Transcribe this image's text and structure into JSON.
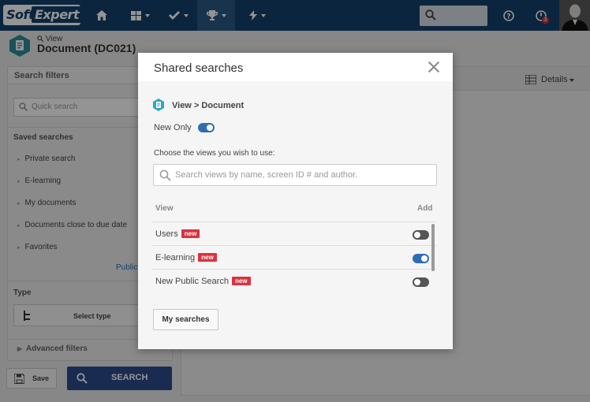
{
  "app": {
    "logo_part1": "Soft",
    "logo_part2": "Expert",
    "notification_count": "3"
  },
  "page": {
    "view_link": "View",
    "title": "Document (DC021)"
  },
  "left_panel": {
    "header": "Search filters",
    "quick_search_placeholder": "Quick search",
    "saved_searches_title": "Saved searches",
    "saved_searches": [
      {
        "label": "Private search"
      },
      {
        "label": "E-learning"
      },
      {
        "label": "My documents"
      },
      {
        "label": "Documents close to due date"
      },
      {
        "label": "Favorites"
      }
    ],
    "public_link": "Public",
    "type_title": "Type",
    "select_type_label": "Select type",
    "advanced_filters": "Advanced filters"
  },
  "footer": {
    "save_label": "Save",
    "search_label": "SEARCH"
  },
  "right_panel": {
    "details_label": "Details"
  },
  "modal": {
    "title": "Shared searches",
    "breadcrumb": "View > Document",
    "new_only_label": "New Only",
    "new_only_enabled": true,
    "choose_label": "Choose the views you wish to use:",
    "search_placeholder": "Search views by name, screen ID # and author.",
    "col_view": "View",
    "col_add": "Add",
    "rows": [
      {
        "name": "Users",
        "badge": "new",
        "added": false
      },
      {
        "name": "E-learning",
        "badge": "new",
        "added": true
      },
      {
        "name": "New Public Search",
        "badge": "new",
        "added": false
      }
    ],
    "my_searches_label": "My searches"
  },
  "colors": {
    "topbar": "#14416b",
    "accent": "#2f6db3",
    "badge": "#d9333f",
    "search_button": "#2b4a8b"
  }
}
